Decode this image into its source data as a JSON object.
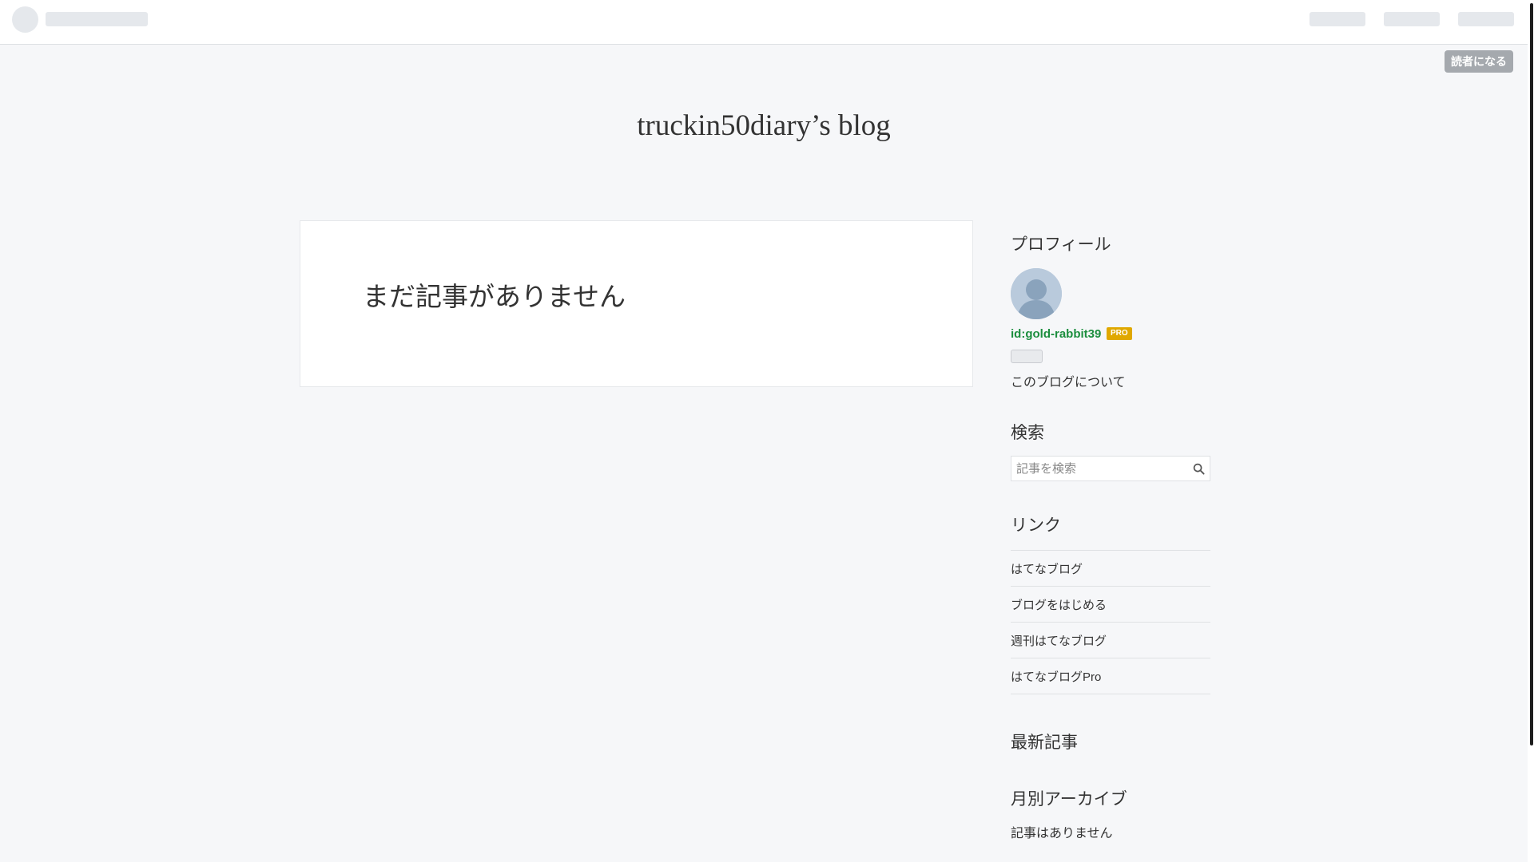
{
  "subscribe": {
    "label": "読者になる"
  },
  "blog": {
    "title": "truckin50diary’s blog"
  },
  "main": {
    "empty_message": "まだ記事がありません"
  },
  "sidebar": {
    "profile": {
      "title": "プロフィール",
      "user_id": "id:gold-rabbit39",
      "badge": "PRO",
      "about_label": "このブログについて"
    },
    "search": {
      "title": "検索",
      "placeholder": "記事を検索",
      "icon": "search-icon"
    },
    "links": {
      "title": "リンク",
      "items": [
        {
          "label": "はてなブログ"
        },
        {
          "label": "ブログをはじめる"
        },
        {
          "label": "週刊はてなブログ"
        },
        {
          "label": "はてなブログPro"
        }
      ]
    },
    "recent": {
      "title": "最新記事"
    },
    "archive": {
      "title": "月別アーカイブ",
      "empty_label": "記事はありません"
    }
  },
  "colors": {
    "background": "#f6f7f9",
    "profile_link": "#1c8e3e",
    "pro_badge": "#e0a800",
    "subscribe_button": "#a5a9ae"
  }
}
